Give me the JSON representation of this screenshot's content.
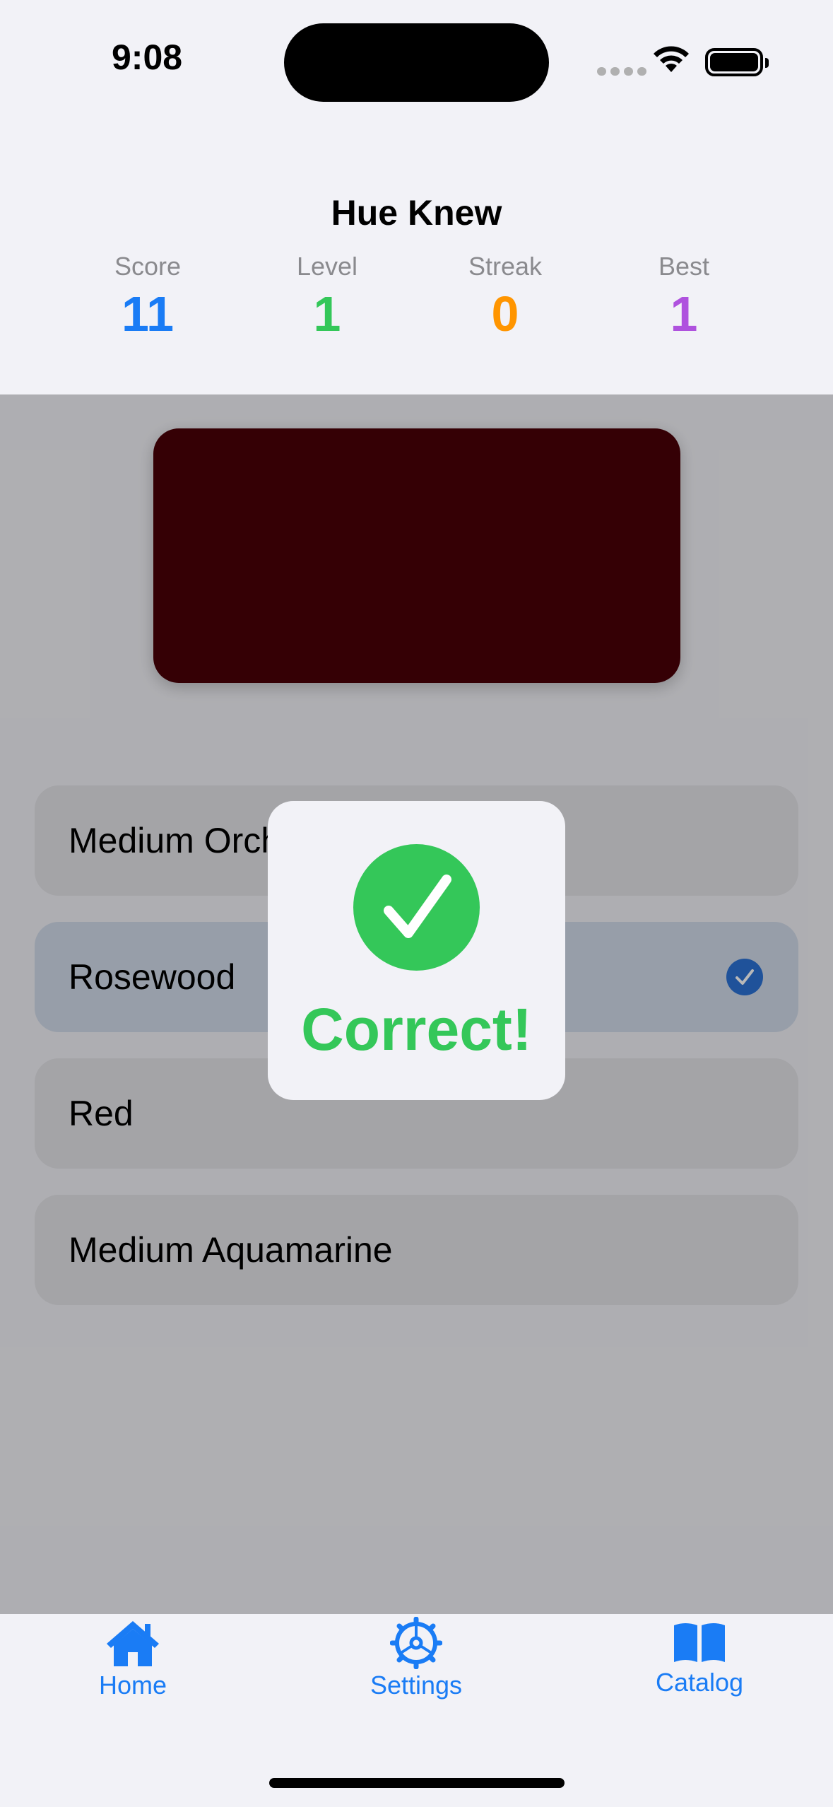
{
  "status_bar": {
    "time": "9:08"
  },
  "header": {
    "title": "Hue Knew",
    "stats": [
      {
        "label": "Score",
        "value": "11",
        "color": "#1a7cf5"
      },
      {
        "label": "Level",
        "value": "1",
        "color": "#34c759"
      },
      {
        "label": "Streak",
        "value": "0",
        "color": "#ff9500"
      },
      {
        "label": "Best",
        "value": "1",
        "color": "#af52de"
      }
    ]
  },
  "swatch": {
    "color": "#4a0008"
  },
  "options": [
    {
      "label": "Medium Orchid",
      "selected": false
    },
    {
      "label": "Rosewood",
      "selected": true,
      "icon": "checkmark-circle-icon"
    },
    {
      "label": "Red",
      "selected": false
    },
    {
      "label": "Medium Aquamarine",
      "selected": false
    }
  ],
  "popup": {
    "text": "Correct!",
    "icon": "checkmark-circle-icon",
    "color": "#34c759"
  },
  "tabbar": {
    "items": [
      {
        "label": "Home",
        "icon": "house-icon"
      },
      {
        "label": "Settings",
        "icon": "gear-icon"
      },
      {
        "label": "Catalog",
        "icon": "book-icon"
      }
    ],
    "accent": "#1a7cf5"
  }
}
